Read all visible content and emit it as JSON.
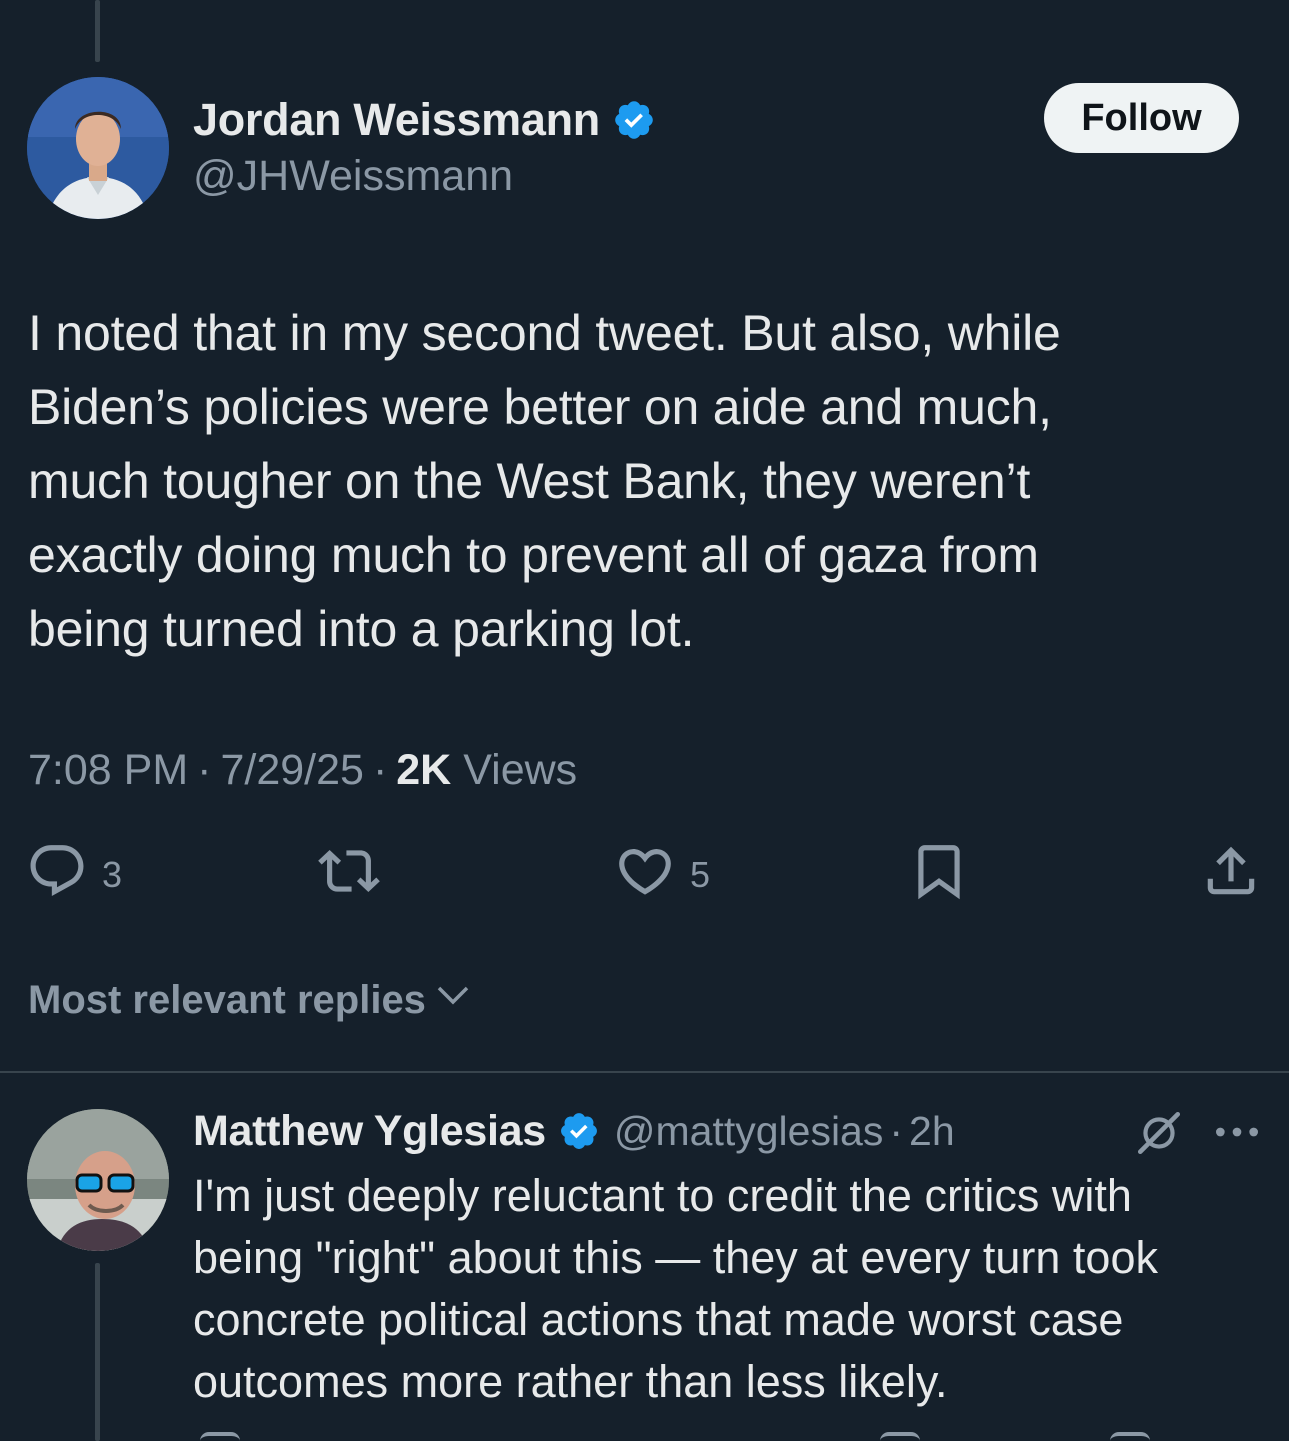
{
  "main_tweet": {
    "author": {
      "display_name": "Jordan Weissmann",
      "handle": "@JHWeissmann",
      "verified": true
    },
    "follow_label": "Follow",
    "text_lines": [
      "I noted that in my second tweet. But also, while",
      "Biden’s policies were better on aide and much,",
      "much tougher on the West Bank, they weren’t",
      "exactly doing much to prevent all of gaza from",
      "being turned into a parking lot."
    ],
    "time": "7:08 PM",
    "date": "7/29/25",
    "views_count": "2K",
    "views_label": "Views",
    "separator": "·",
    "actions": {
      "reply_count": "3",
      "retweet_count": "",
      "like_count": "5"
    }
  },
  "replies_sort_label": "Most relevant replies",
  "reply": {
    "author": {
      "display_name": "Matthew Yglesias",
      "handle": "@mattyglesias",
      "verified": true
    },
    "time": "2h",
    "text_lines": [
      "I'm just deeply reluctant to credit the critics with",
      "being \"right\" about this — they at every turn took",
      "concrete political actions that made worst case",
      "outcomes more rather than less likely."
    ]
  },
  "colors": {
    "background": "#15202b",
    "text_primary": "#e7e9ea",
    "text_secondary": "#8b98a5",
    "verified_blue": "#1d9bf0",
    "divider": "#38444d",
    "follow_bg": "#eff3f4"
  },
  "icons": [
    "reply-icon",
    "retweet-icon",
    "like-icon",
    "bookmark-icon",
    "share-icon",
    "chevron-down-icon",
    "grok-icon",
    "more-icon",
    "verified-badge-icon"
  ]
}
